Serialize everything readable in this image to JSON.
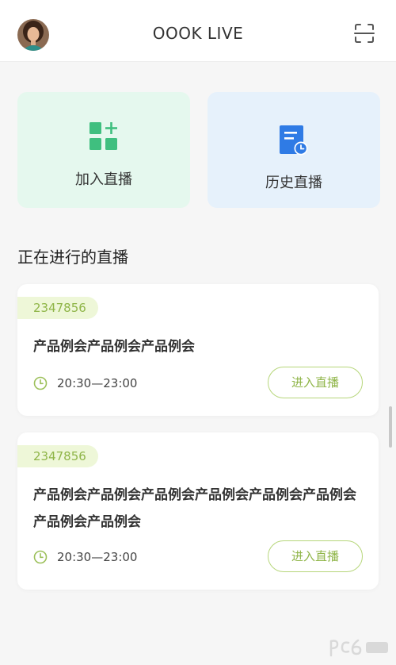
{
  "header": {
    "title": "OOOK LIVE",
    "avatar_icon": "user-avatar",
    "scan_icon": "scan-icon"
  },
  "quick_actions": [
    {
      "label": "加入直播",
      "icon": "grid-plus-icon",
      "color": "#3fbf7f"
    },
    {
      "label": "历史直播",
      "icon": "history-document-icon",
      "color": "#2f7be5"
    }
  ],
  "section": {
    "title": "正在进行的直播"
  },
  "live_list": [
    {
      "room_id": "2347856",
      "title": "产品例会产品例会产品例会",
      "time": "20:30—23:00",
      "button_label": "进入直播"
    },
    {
      "room_id": "2347856",
      "title": "产品例会产品例会产品例会产品例会产品例会产品例会产品例会产品例会",
      "time": "20:30—23:00",
      "button_label": "进入直播"
    }
  ],
  "colors": {
    "accent_green": "#8fb548",
    "join_bg": "#e5f8ee",
    "history_bg": "#e6f1fb"
  }
}
